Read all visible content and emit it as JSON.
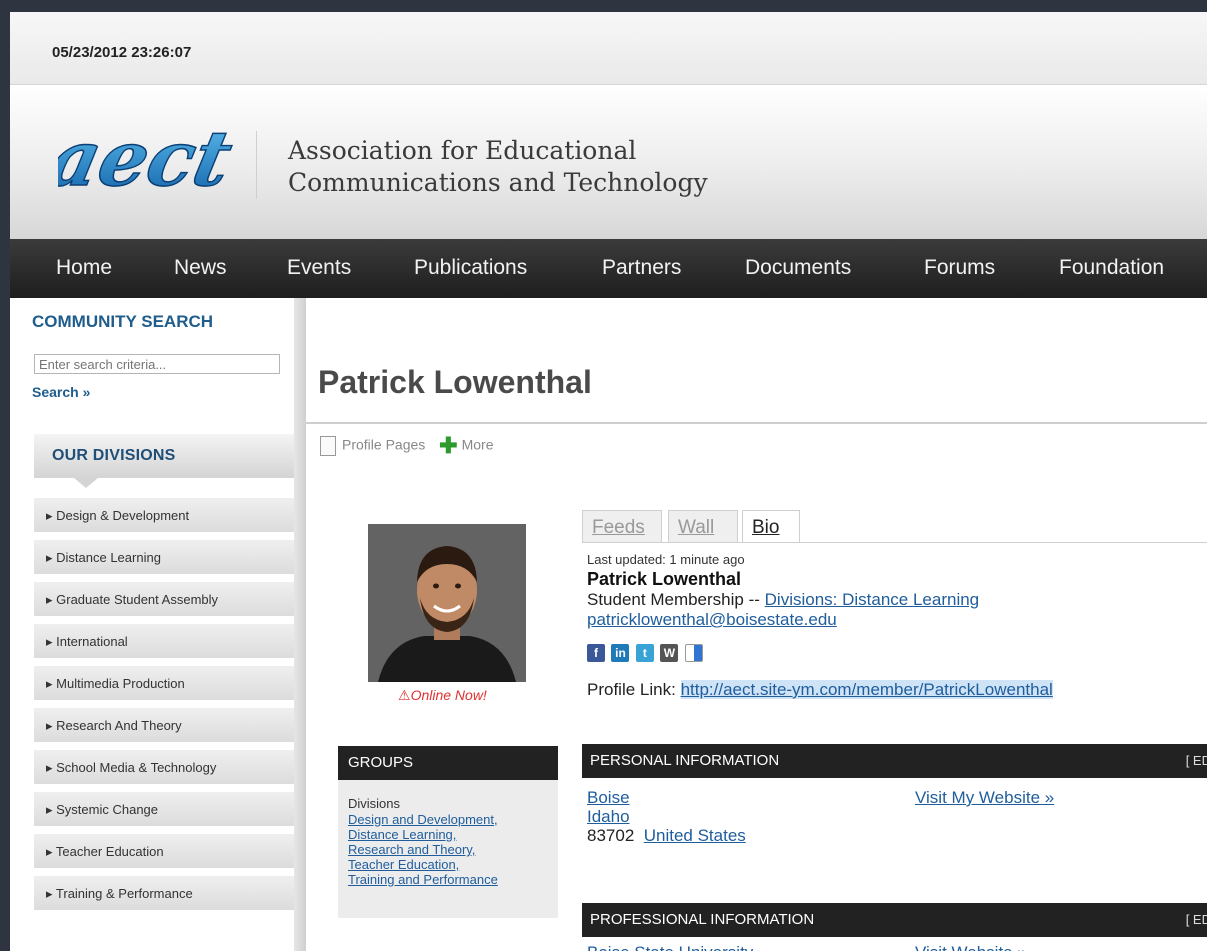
{
  "datebar": {
    "timestamp": "05/23/2012 23:26:07"
  },
  "header": {
    "logo_text": "aect",
    "org_line1": "Association for Educational",
    "org_line2": "Communications and Technology"
  },
  "nav": [
    "Home",
    "News",
    "Events",
    "Publications",
    "Partners",
    "Documents",
    "Forums",
    "Foundation"
  ],
  "sidebar": {
    "search_title": "COMMUNITY SEARCH",
    "search_placeholder": "Enter search criteria...",
    "search_link": "Search »",
    "divisions_title": "OUR DIVISIONS",
    "divisions": [
      "Design & Development",
      "Distance Learning",
      "Graduate Student Assembly",
      "International",
      "Multimedia Production",
      "Research And Theory",
      "School Media & Technology",
      "Systemic Change",
      "Teacher Education",
      "Training & Performance"
    ]
  },
  "main": {
    "page_title": "Patrick Lowenthal",
    "toolbar": {
      "profile_pages": "Profile Pages",
      "more": "More"
    },
    "online_status": "Online Now!",
    "groups": {
      "title": "GROUPS",
      "label": "Divisions",
      "links": [
        "Design and Development,",
        "Distance Learning,",
        "Research and Theory,",
        "Teacher Education,",
        "Training and Performance"
      ]
    },
    "tabs": [
      "Feeds",
      "Wall",
      "Bio"
    ],
    "bio": {
      "last_updated": "Last updated: 1 minute ago",
      "name": "Patrick Lowenthal",
      "membership": "Student Membership --",
      "membership_link": "Divisions: Distance Learning",
      "email": "patricklowenthal@boisestate.edu",
      "profile_link_label": "Profile Link:",
      "profile_link_url": "http://aect.site-ym.com/member/PatrickLowenthal"
    },
    "personal": {
      "title": "PERSONAL INFORMATION",
      "edit": "[ ED",
      "city": "Boise",
      "state": "Idaho",
      "zip": "83702",
      "country": "United States",
      "website": "Visit My Website »"
    },
    "professional": {
      "title": "PROFESSIONAL INFORMATION",
      "edit": "[ ED",
      "company": "Boise State University",
      "website": "Visit Website »"
    }
  }
}
